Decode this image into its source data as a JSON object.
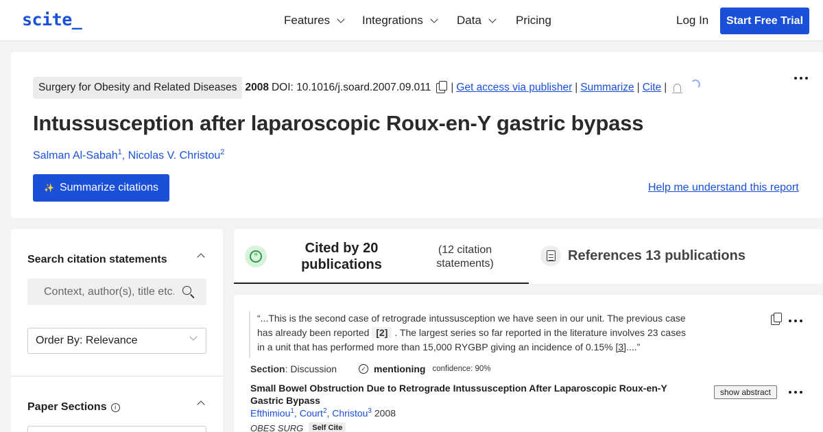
{
  "nav": {
    "logo": "scite_",
    "items": [
      {
        "label": "Features"
      },
      {
        "label": "Integrations"
      },
      {
        "label": "Data"
      },
      {
        "label": "Pricing"
      }
    ],
    "login": "Log In",
    "trial": "Start Free Trial"
  },
  "paper": {
    "journal": "Surgery for Obesity and Related Diseases",
    "year": "2008",
    "doi": "DOI: 10.1016/j.soard.2007.09.011",
    "links": {
      "access": "Get access via publisher",
      "summarize": "Summarize",
      "cite": "Cite"
    },
    "title": "Intussusception after laparoscopic Roux-en-Y gastric bypass",
    "authors": [
      {
        "name": "Salman Al-Sabah",
        "sup": "1"
      },
      {
        "name": "Nicolas V. Christou",
        "sup": "2"
      }
    ],
    "summarize_citations": "Summarize citations",
    "help_link": "Help me understand this report"
  },
  "sidebar": {
    "search_heading": "Search citation statements",
    "search_placeholder": "Context, author(s), title etc.",
    "order_by": "Order By: Relevance",
    "sections_heading": "Paper Sections"
  },
  "tabs": {
    "cited_main": "Cited by 20 publications",
    "cited_sub": "(12 citation statements)",
    "references": "References 13 publications"
  },
  "citation": {
    "quote_part1": "“...This is the second case of retrograde intussusception we have seen in our unit. The previous case has already been reported",
    "ref1": "[2]",
    "quote_part2": ". The largest series so far reported in the literature involves 23 cases in a unit that has performed more than 15,000 RYGBP giving an incidence of 0.15%",
    "ref2": "[3]",
    "quote_end": "....”",
    "section_label": "Section",
    "section_value": ": Discussion",
    "type": "mentioning",
    "confidence": "confidence: 90%",
    "pub_title": "Small Bowel Obstruction Due to Retrograde Intussusception After Laparoscopic Roux-en-Y Gastric Bypass",
    "show_abstract": "show abstract",
    "pub_authors": [
      {
        "name": "Efthimiou",
        "sup": "1"
      },
      {
        "name": "Court",
        "sup": "2"
      },
      {
        "name": "Christou",
        "sup": "3"
      }
    ],
    "pub_year": "2008",
    "journal": "OBES SURG",
    "self_cite": "Self Cite"
  }
}
